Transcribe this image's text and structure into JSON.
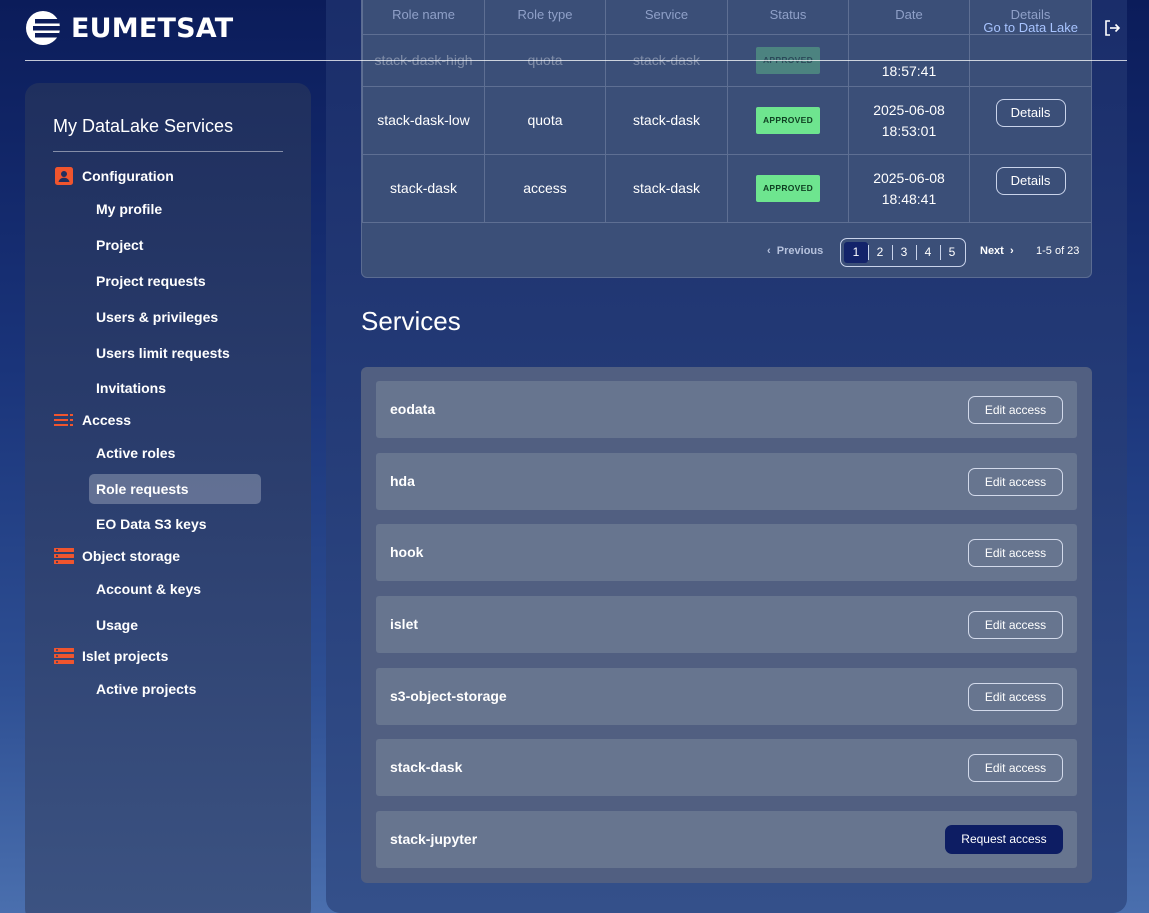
{
  "header": {
    "logo_text": "EUMETSAT",
    "datalake_link": "Go to Data Lake"
  },
  "sidebar": {
    "title": "My DataLake Services",
    "sections": {
      "configuration": {
        "label": "Configuration",
        "items": [
          "My profile",
          "Project",
          "Project requests",
          "Users & privileges",
          "Users limit requests",
          "Invitations"
        ]
      },
      "access": {
        "label": "Access",
        "items": [
          "Active roles",
          "Role requests",
          "EO Data S3 keys"
        ]
      },
      "object_storage": {
        "label": "Object storage",
        "items": [
          "Account & keys",
          "Usage"
        ]
      },
      "islet_projects": {
        "label": "Islet projects",
        "items": [
          "Active projects"
        ]
      }
    },
    "active_item": "Role requests"
  },
  "requests_table": {
    "headers": [
      "Role name",
      "Role type",
      "Service",
      "Status",
      "Date",
      "Details"
    ],
    "rows": [
      {
        "role": "stack-dask-high",
        "type": "quota",
        "service": "stack-dask",
        "status": "APPROVED",
        "date": "",
        "time": "18:57:41",
        "action": ""
      },
      {
        "role": "stack-dask-low",
        "type": "quota",
        "service": "stack-dask",
        "status": "APPROVED",
        "date": "2025-06-08",
        "time": "18:53:01",
        "action": "Details"
      },
      {
        "role": "stack-dask",
        "type": "access",
        "service": "stack-dask",
        "status": "APPROVED",
        "date": "2025-06-08",
        "time": "18:48:41",
        "action": "Details"
      }
    ],
    "pagination": {
      "previous": "Previous",
      "next": "Next",
      "pages": [
        "1",
        "2",
        "3",
        "4",
        "5"
      ],
      "current": "1",
      "range": "1-5 of 23"
    }
  },
  "services": {
    "title": "Services",
    "items": [
      {
        "name": "eodata",
        "action": "Edit access"
      },
      {
        "name": "hda",
        "action": "Edit access"
      },
      {
        "name": "hook",
        "action": "Edit access"
      },
      {
        "name": "islet",
        "action": "Edit access"
      },
      {
        "name": "s3-object-storage",
        "action": "Edit access"
      },
      {
        "name": "stack-dask",
        "action": "Edit access"
      },
      {
        "name": "stack-jupyter",
        "action": "Request access"
      }
    ]
  },
  "colors": {
    "accent_icon": "#f0552e",
    "badge_approved": "#6ee58f",
    "primary_button": "#0d1d63",
    "link": "#a8c4ff"
  },
  "icons": {
    "logout": "logout-icon",
    "configuration": "account-box-icon",
    "access": "list-icon",
    "object_storage": "storage-icon",
    "islet_projects": "storage-icon"
  }
}
